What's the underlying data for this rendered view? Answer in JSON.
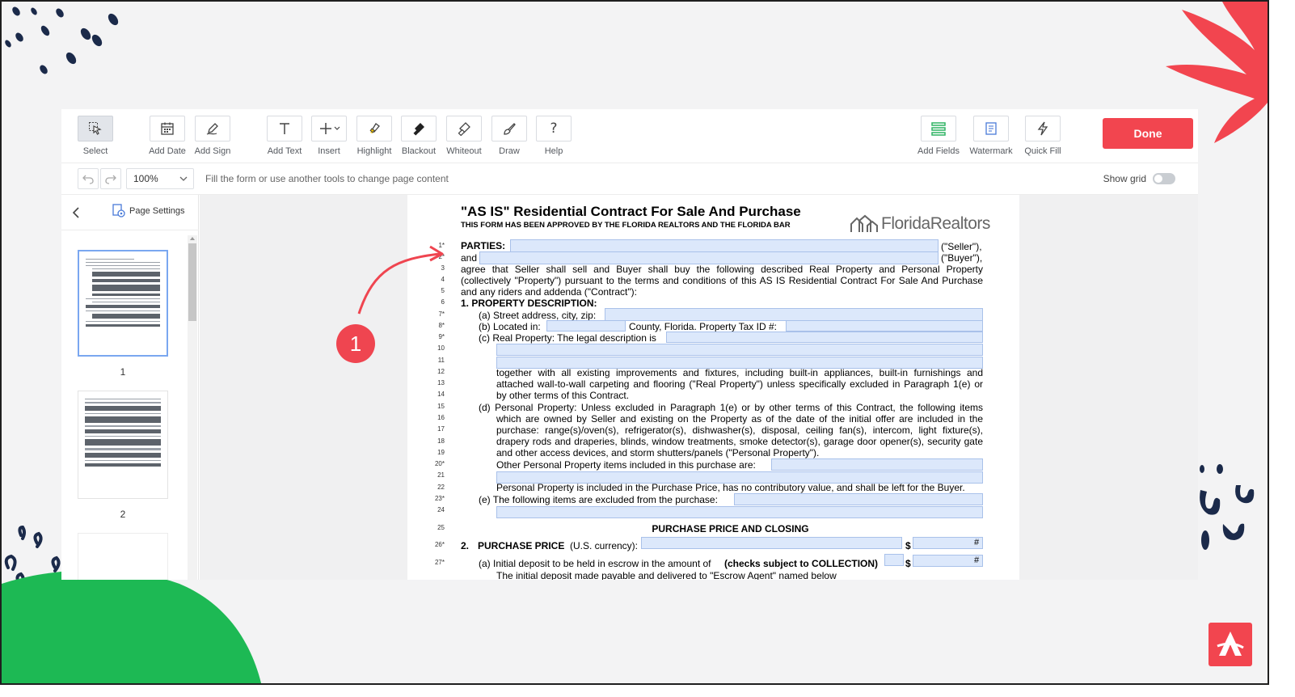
{
  "toolbar": {
    "tools": [
      {
        "label": "Select",
        "icon": "select-cursor-icon"
      },
      {
        "label": "Add Date",
        "icon": "calendar-icon"
      },
      {
        "label": "Add Sign",
        "icon": "signature-pen-icon"
      },
      {
        "label": "Add Text",
        "icon": "text-t-icon"
      },
      {
        "label": "Insert",
        "icon": "plus-icon"
      },
      {
        "label": "Highlight",
        "icon": "highlighter-icon"
      },
      {
        "label": "Blackout",
        "icon": "blackout-icon"
      },
      {
        "label": "Whiteout",
        "icon": "whiteout-icon"
      },
      {
        "label": "Draw",
        "icon": "brush-icon"
      },
      {
        "label": "Help",
        "icon": "question-icon"
      },
      {
        "label": "Add Fields",
        "icon": "fields-icon"
      },
      {
        "label": "Watermark",
        "icon": "watermark-icon"
      },
      {
        "label": "Quick Fill",
        "icon": "lightning-icon"
      }
    ],
    "done_label": "Done"
  },
  "subbar": {
    "zoom": "100%",
    "hint": "Fill the form or use another tools to change page content",
    "show_grid_label": "Show grid"
  },
  "sidebar": {
    "page_settings_label": "Page Settings",
    "pages": [
      "1",
      "2"
    ]
  },
  "annotation": {
    "step": "1"
  },
  "document": {
    "title": "\"AS IS\" Residential Contract For Sale And Purchase",
    "subtitle": "THIS FORM HAS BEEN APPROVED BY THE FLORIDA REALTORS AND THE FLORIDA BAR",
    "logo_text": "FloridaRealtors",
    "line_numbers": [
      "1*",
      "2*",
      "3",
      "4",
      "5",
      "6",
      "7*",
      "8*",
      "9*",
      "10",
      "11",
      "12",
      "13",
      "14",
      "15",
      "16",
      "17",
      "18",
      "19",
      "20*",
      "21",
      "22",
      "23*",
      "24",
      "25",
      "26*",
      "27*"
    ],
    "parties_label": "PARTIES:",
    "seller_suffix": "(\"Seller\"),",
    "and_label": "and",
    "buyer_suffix": "(\"Buyer\"),",
    "line3": "agree that Seller shall sell and Buyer shall buy the following described Real Property and Personal Property",
    "line4": "(collectively \"Property\") pursuant to the terms and conditions of this AS IS Residential Contract For Sale And Purchase",
    "line5": "and any riders and addenda (\"Contract\"):",
    "sec1_heading": "1.  PROPERTY DESCRIPTION:",
    "item_a": "(a)  Street address, city, zip:",
    "item_b": "(b)  Located in:",
    "item_b2": "County, Florida. Property Tax ID #:",
    "item_c": "(c)  Real Property: The legal description is",
    "line12": "together with all existing improvements and fixtures, including built-in appliances, built-in furnishings and",
    "line13": "attached wall-to-wall carpeting and flooring (\"Real Property\") unless specifically excluded in Paragraph 1(e) or",
    "line14": "by other terms of this Contract.",
    "item_d1": "(d)  Personal Property: Unless excluded in Paragraph 1(e) or by other terms of this Contract, the following items",
    "item_d2": "which are owned by Seller and existing on the Property as of the date of the initial offer are included in the",
    "item_d3": "purchase: range(s)/oven(s), refrigerator(s), dishwasher(s), disposal, ceiling fan(s), intercom, light fixture(s),",
    "item_d4": "drapery rods and draperies, blinds, window treatments, smoke detector(s), garage door opener(s), security gate",
    "item_d5": "and other access devices, and storm shutters/panels (\"Personal Property\").",
    "item_d6": "Other Personal Property items included in this purchase are:",
    "item_d7": "Personal Property is included in the Purchase Price, has no contributory value, and shall be left for the Buyer.",
    "item_e": "(e)  The following items are excluded from the purchase:",
    "section_heading": "PURCHASE PRICE AND CLOSING",
    "sec2_num": "2.",
    "sec2_label": "PURCHASE PRICE",
    "sec2_rest": "(U.S. currency):",
    "item_2a": "(a)  Initial deposit to be held in escrow in the amount of",
    "item_2a_bold": "(checks subject to COLLECTION)",
    "dollar": "$",
    "hash": "#",
    "cut_line": "The initial deposit made payable and delivered to \"Escrow Agent\" named below"
  }
}
